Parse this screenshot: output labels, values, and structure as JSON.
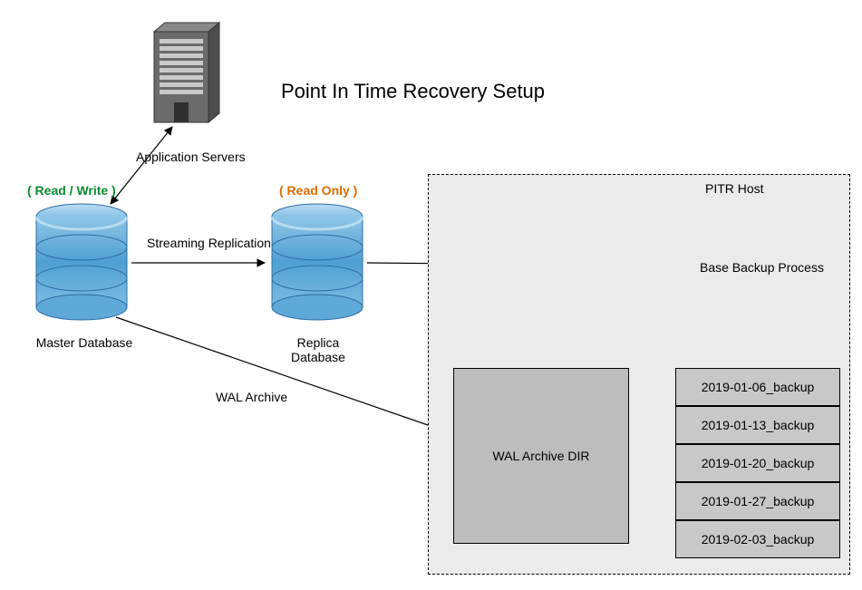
{
  "title": "Point In Time Recovery Setup",
  "app_servers_label": "Application Servers",
  "read_write_label": "( Read / Write )",
  "read_only_label": "( Read Only )",
  "master_db_label": "Master Database",
  "replica_db_label": "Replica Database",
  "streaming_label": "Streaming Replication",
  "wal_archive_label": "WAL Archive",
  "pitr_host_label": "PITR Host",
  "base_backup_label": "Base Backup Process",
  "wal_dir_label": "WAL Archive DIR",
  "backups": [
    "2019-01-06_backup",
    "2019-01-13_backup",
    "2019-01-20_backup",
    "2019-01-27_backup",
    "2019-02-03_backup"
  ]
}
